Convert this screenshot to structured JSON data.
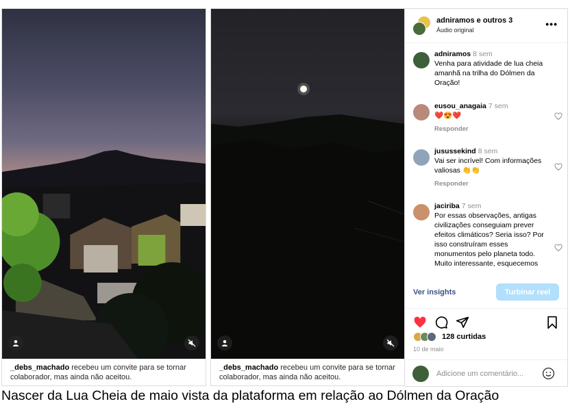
{
  "reels": [
    {
      "collab_user": "_debs_machado",
      "collab_text": "recebeu um convite para se tornar colaborador, mas ainda não aceitou."
    },
    {
      "collab_user": "_debs_machado",
      "collab_text": "recebeu um convite para se tornar colaborador, mas ainda não aceitou."
    }
  ],
  "video_icons": {
    "left": "user-icon",
    "right": "muted-speaker-icon"
  },
  "post": {
    "header_names": "adniramos e outros 3",
    "header_audio": "Áudio original",
    "more_icon": "more-horizontal-icon",
    "comments": [
      {
        "user": "adniramos",
        "time": "8 sem",
        "text": "Venha para atividade de lua cheia amanhã na trilha do Dólmen da Oração!",
        "reply": ""
      },
      {
        "user": "eusou_anagaia",
        "time": "7 sem",
        "text": "❤️😍❤️",
        "reply": "Responder"
      },
      {
        "user": "jusussekind",
        "time": "8 sem",
        "text": "Vai ser incrível! Com informações valiosas 👏👏",
        "reply": "Responder"
      },
      {
        "user": "jaciriba",
        "time": "7 sem",
        "text": "Por essas observações, antigas civilizações conseguiam prever efeitos climáticos? Seria isso? Por isso construíram esses monumentos pelo planeta todo. Muito interessante, esquecemos",
        "reply": ""
      }
    ],
    "insights_label": "Ver insights",
    "boost_label": "Turbinar reel",
    "likes_text": "128 curtidas",
    "date": "10 de maio",
    "comment_placeholder": "Adicione um comentário...",
    "accent_color": "#0095f6",
    "like_color": "#ff3040"
  },
  "figure_caption": "Nascer da Lua Cheia de maio vista da plataforma em relação ao Dólmen da Oração"
}
